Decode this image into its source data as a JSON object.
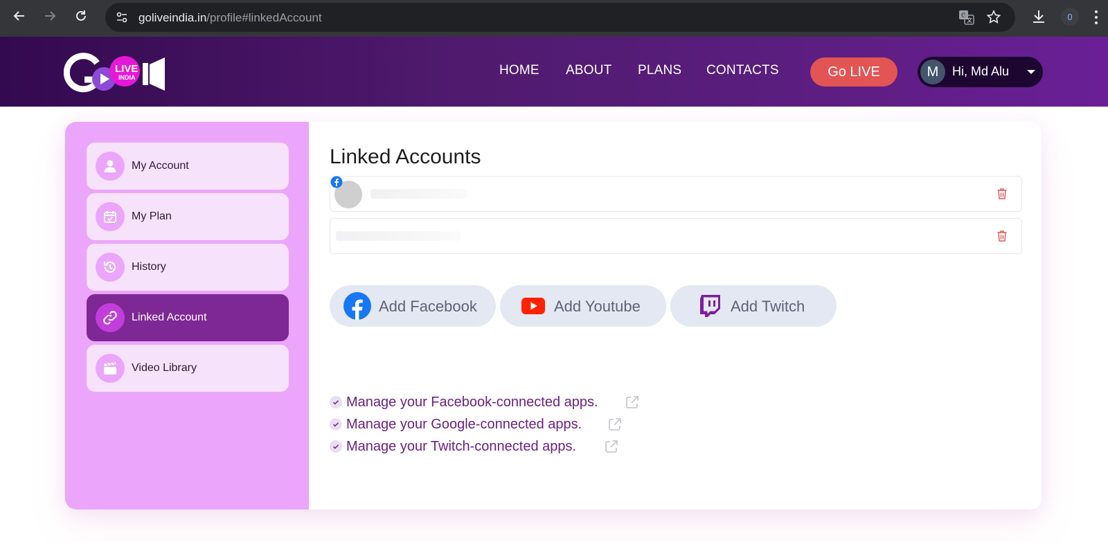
{
  "browser": {
    "url_host": "goliveindia.in",
    "url_path": "/profile#linkedAccount",
    "extension_badge": "0"
  },
  "header": {
    "logo_badge": "LIVE",
    "logo_sub": "INDIA",
    "nav": [
      {
        "label": "HOME"
      },
      {
        "label": "ABOUT"
      },
      {
        "label": "PLANS"
      },
      {
        "label": "CONTACTS"
      }
    ],
    "go_live": "Go LIVE",
    "user": {
      "initial": "M",
      "greeting": "Hi,  Md Alu"
    }
  },
  "sidebar": {
    "items": [
      {
        "label": "My Account",
        "icon": "user-icon",
        "active": false
      },
      {
        "label": "My Plan",
        "icon": "calendar-check-icon",
        "active": false
      },
      {
        "label": "History",
        "icon": "history-icon",
        "active": false
      },
      {
        "label": "Linked Account",
        "icon": "link-icon",
        "active": true
      },
      {
        "label": "Video Library",
        "icon": "clapperboard-icon",
        "active": false
      }
    ]
  },
  "main": {
    "title": "Linked Accounts",
    "add_buttons": [
      {
        "label": "Add Facebook",
        "icon": "facebook-icon"
      },
      {
        "label": "Add Youtube",
        "icon": "youtube-icon"
      },
      {
        "label": "Add Twitch",
        "icon": "twitch-icon"
      }
    ],
    "manage_links": [
      {
        "label": "Manage your Facebook-connected apps."
      },
      {
        "label": "Manage your Google-connected apps."
      },
      {
        "label": "Manage your Twitch-connected apps."
      }
    ]
  },
  "colors": {
    "header_start": "#33094f",
    "header_end": "#6a1f96",
    "go_live": "#e35454",
    "sidebar_bg": "#eba5fb",
    "sidebar_active": "#7d2894",
    "link_text": "#6b1f86",
    "delete_icon": "#e35454"
  }
}
